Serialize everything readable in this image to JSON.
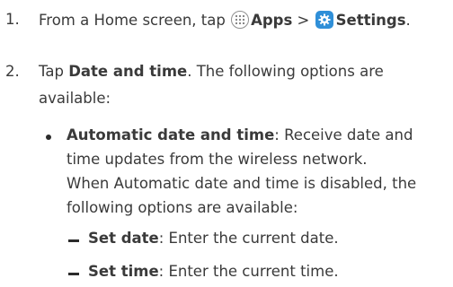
{
  "steps": [
    {
      "number": "1.",
      "prefix": "From a Home screen, tap ",
      "apps_label": "Apps",
      "separator": " > ",
      "settings_label": "Settings",
      "suffix": "."
    },
    {
      "number": "2.",
      "prefix": "Tap ",
      "bold": "Date and time",
      "line1_rest": ". The following options are",
      "line2": "available:"
    }
  ],
  "options": [
    {
      "title": "Automatic date and time",
      "desc_line1": ": Receive date and",
      "desc_line2": "time updates from the wireless network.",
      "desc_line3": "When Automatic date and time is disabled, the",
      "desc_line4": "following options are available:"
    }
  ],
  "sub_options": [
    {
      "title": "Set date",
      "desc": ": Enter the current date."
    },
    {
      "title": "Set time",
      "desc": ": Enter the current time."
    }
  ],
  "icons": {
    "apps": "apps-grid-icon",
    "settings": "gear-icon",
    "settings_color": "#2f8fd8"
  }
}
